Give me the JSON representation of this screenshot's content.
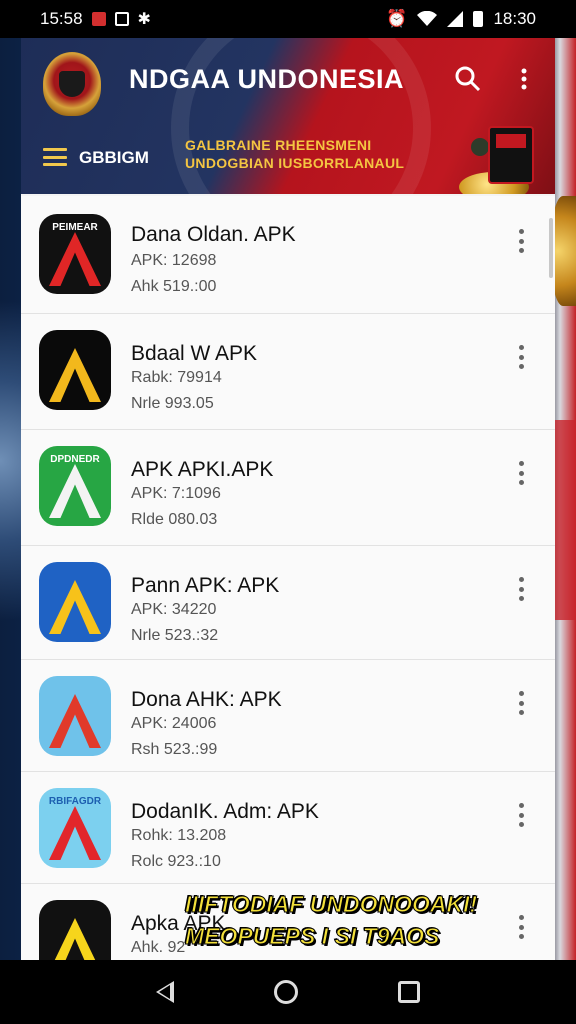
{
  "status_bar": {
    "time_left": "15:58",
    "time_right": "18:30"
  },
  "header": {
    "title": "NDGAA UNDONESIA",
    "menu_label": "GBBIGM",
    "banner_line1": "GALBRAINE RHEENSMENI",
    "banner_line2": "UNDOGBIAN IUSBORRLANAUL"
  },
  "apps": [
    {
      "name": "Dana Oldan. APK",
      "line1": "APK: 12698",
      "line2": "Ahk 519.:00",
      "icon_label": "PEIMEAR",
      "bg": "#111111",
      "glyph": "#e02626",
      "label_color": "#ffffff"
    },
    {
      "name": "Bdaal W APK",
      "line1": "Rabk: 79914",
      "line2": "Nrle 993.05",
      "icon_label": "",
      "bg": "#0a0a0a",
      "glyph": "#f2b81c",
      "label_color": "#ffffff"
    },
    {
      "name": "APK APKI.APK",
      "line1": "APK: 7:1096",
      "line2": "Rlde 080.03",
      "icon_label": "DPDNEDR",
      "bg": "#27a644",
      "glyph": "#f3f3f3",
      "label_color": "#ffffff"
    },
    {
      "name": "Pann APK: APK",
      "line1": "APK: 34220",
      "line2": "Nrle 523.:32",
      "icon_label": "",
      "bg": "#1f62c4",
      "glyph": "#f7c21a",
      "label_color": "#ffffff"
    },
    {
      "name": "Dona AHK: APK",
      "line1": "APK: 24006",
      "line2": "Rsh 523.:99",
      "icon_label": "",
      "bg": "#6fc2ea",
      "glyph": "#e03a2a",
      "label_color": "#ffffff"
    },
    {
      "name": "DodanIK. Adm: APK",
      "line1": "Rohk: 13.208",
      "line2": "Rolc 923.:10",
      "icon_label": "RBIFAGDR",
      "bg": "#7cd0ef",
      "glyph": "#e2262b",
      "label_color": "#1d5fb0"
    },
    {
      "name": "Apka APK",
      "line1": "Ahk. 92",
      "line2": "",
      "icon_label": "",
      "bg": "#111111",
      "glyph": "#f6d51c",
      "label_color": "#ffffff"
    }
  ],
  "caption": {
    "line1": "IIIFTODIAF UNDONOOAKI!",
    "line2": "MEOPUEPS I SI T9AOS"
  }
}
